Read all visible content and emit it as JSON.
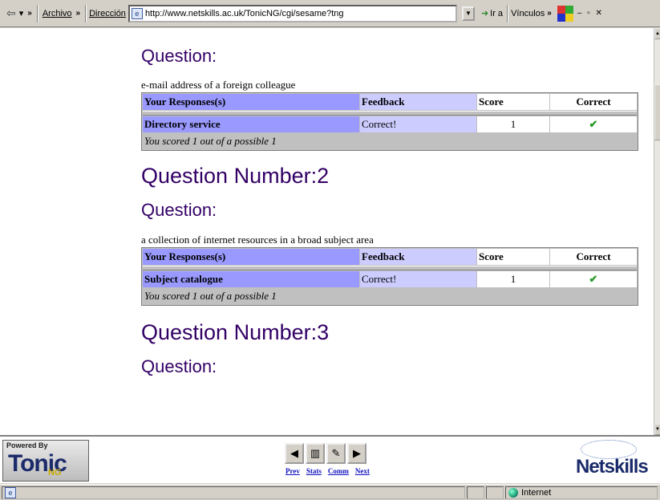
{
  "toolbar": {
    "back_glyph": "⇦",
    "back_dropdown": "▾",
    "more_chevron": "»",
    "menu_archivo": "Archivo",
    "address_label": "Dirección",
    "address_url": "http://www.netskills.ac.uk/TonicNG/cgi/sesame?tng",
    "go_label": "Ir a",
    "links_label": "Vínculos",
    "window_controls": "– ▫ ✕"
  },
  "content": {
    "q1": {
      "question_label": "Question:",
      "question_text": "e-mail address of a foreign colleague",
      "headers": [
        "Your Responses(s)",
        "Feedback",
        "Score",
        "Correct"
      ],
      "response": "Directory service",
      "feedback": "Correct!",
      "score": "1",
      "correct_mark": "✔",
      "summary": "You scored 1 out of a possible 1"
    },
    "q2": {
      "number_label": "Question Number:2",
      "question_label": "Question:",
      "question_text": "a collection of internet resources in a broad subject area",
      "headers": [
        "Your Responses(s)",
        "Feedback",
        "Score",
        "Correct"
      ],
      "response": "Subject catalogue",
      "feedback": "Correct!",
      "score": "1",
      "correct_mark": "✔",
      "summary": "You scored 1 out of a possible 1"
    },
    "q3": {
      "number_label": "Question Number:3",
      "question_label": "Question:"
    }
  },
  "navframe": {
    "powered_by": "Powered By",
    "tonic_word": "Tonic",
    "tonic_ng": "NG",
    "prev_glyph": "◀",
    "stats_glyph": "▥",
    "comm_glyph": "✎",
    "next_glyph": "▶",
    "prev_label": "Prev",
    "stats_label": "Stats",
    "comm_label": "Comm",
    "next_label": "Next",
    "netskills_word": "Netskills"
  },
  "statusbar": {
    "zone": "Internet"
  }
}
